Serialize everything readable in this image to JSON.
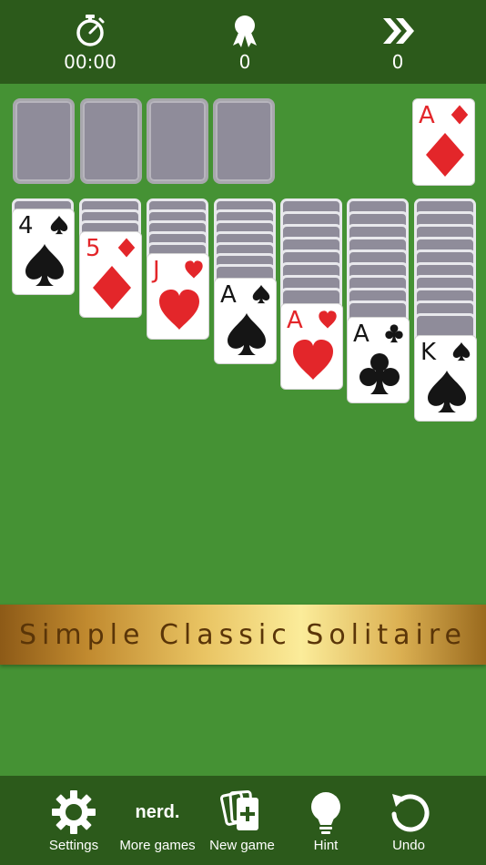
{
  "stats": {
    "time": "00:00",
    "score": "0",
    "moves": "0"
  },
  "foundation_card": {
    "rank": "A",
    "suit": "diamond"
  },
  "tableau": [
    {
      "rank": "4",
      "suit": "spade"
    },
    {
      "rank": "5",
      "suit": "diamond"
    },
    {
      "rank": "J",
      "suit": "heart"
    },
    {
      "rank": "A",
      "suit": "spade"
    },
    {
      "rank": "A",
      "suit": "heart"
    },
    {
      "rank": "A",
      "suit": "club"
    },
    {
      "rank": "K",
      "suit": "spade"
    }
  ],
  "banner": "Simple Classic Solitaire",
  "toolbar": {
    "settings": "Settings",
    "more_games_logo": "nerd.",
    "more_games": "More games",
    "new_game": "New game",
    "hint": "Hint",
    "undo": "Undo"
  },
  "colors": {
    "felt": "#459234",
    "bar": "#2c5a1b",
    "red_suit": "#e3262a",
    "black_suit": "#151515"
  }
}
